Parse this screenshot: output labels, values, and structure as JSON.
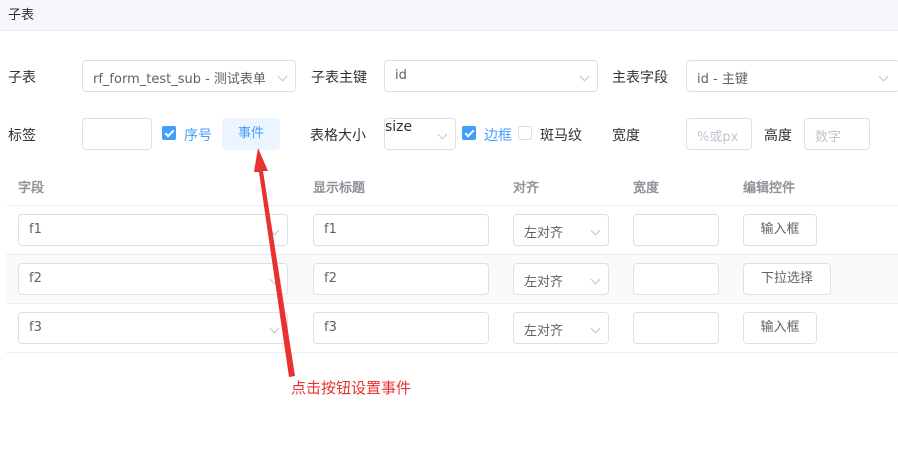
{
  "section": {
    "title": "子表"
  },
  "form": {
    "subtable_label": "子表",
    "subtable_value": "rf_form_test_sub - 测试表单",
    "subkey_label": "子表主键",
    "subkey_value": "id",
    "mainfield_label": "主表字段",
    "mainfield_value": "id - 主键",
    "title_label": "标签",
    "title_value": "",
    "serial_label": "序号",
    "serial_checked": true,
    "event_button": "事件",
    "size_label": "表格大小",
    "size_value": "size",
    "border_label": "边框",
    "border_checked": true,
    "stripe_label": "斑马纹",
    "stripe_checked": false,
    "width_label": "宽度",
    "width_placeholder": "%或px",
    "height_label": "高度",
    "height_placeholder": "数字"
  },
  "table": {
    "headers": [
      "字段",
      "显示标题",
      "对齐",
      "宽度",
      "编辑控件"
    ],
    "rows": [
      {
        "field": "f1",
        "title": "f1",
        "align": "左对齐",
        "width": "",
        "control": "输入框"
      },
      {
        "field": "f2",
        "title": "f2",
        "align": "左对齐",
        "width": "",
        "control": "下拉选择"
      },
      {
        "field": "f3",
        "title": "f3",
        "align": "左对齐",
        "width": "",
        "control": "输入框"
      }
    ]
  },
  "annotation": {
    "text": "点击按钮设置事件",
    "color": "#e8322f"
  },
  "colors": {
    "primary": "#409eff",
    "border": "#dcdfe6",
    "header_bg": "#f5f7fa"
  }
}
